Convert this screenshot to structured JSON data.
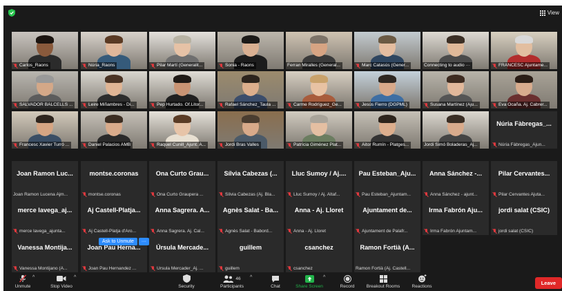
{
  "header": {
    "view_label": "View"
  },
  "video_tiles": [
    {
      "name": "Carlos_Raons",
      "muted": true,
      "wall": "#c9c4bf",
      "skin": "#8a5a3c",
      "shirt": "#2b2b2b",
      "hair": "#1b1410"
    },
    {
      "name": "Núria_Raons",
      "muted": true,
      "wall": "#d8d2cb",
      "skin": "#e0b79a",
      "shirt": "#355a7a",
      "hair": "#5a3a24"
    },
    {
      "name": "Pilar Martí (Generalit...",
      "muted": true,
      "wall": "#e4e1dc",
      "skin": "#e6c2a6",
      "shirt": "#6f6f6f",
      "hair": "#b8b3a4"
    },
    {
      "name": "Sonia - Raons",
      "muted": true,
      "wall": "#bdb7ad",
      "skin": "#d9b092",
      "shirt": "#1c1c1c",
      "hair": "#1c1a18"
    },
    {
      "name": "Ferran Miralles (General...",
      "muted": false,
      "active": true,
      "wall": "#cfc3b2",
      "skin": "#d7a483",
      "shirt": "#3a3a3a",
      "hair": "#7d7368"
    },
    {
      "name": "Marc Catasús (Gener...",
      "muted": true,
      "wall": "#c3cbd0",
      "skin": "#e4bda0",
      "shirt": "#2f4660",
      "hair": "#6b5a44"
    },
    {
      "name": "Connecting to audio ···",
      "muted": false,
      "wall": "#dedad3",
      "skin": "#e0b999",
      "shirt": "#4a4a4a",
      "hair": "#3b2f25"
    },
    {
      "name": "FRANCESC Ajuntame...",
      "muted": true,
      "wall": "#d8d0c0",
      "skin": "#e2bea0",
      "shirt": "#b22c2c",
      "hair": "#d9d9d9"
    },
    {
      "name": "SALVADOR BALCELLS ...",
      "muted": true,
      "wall": "#b9b6b0",
      "skin": "#d4a888",
      "shirt": "#5c5c5c",
      "hair": "#999"
    },
    {
      "name": "Leire Miñambres - Di...",
      "muted": true,
      "wall": "#d9d6cf",
      "skin": "#e0b595",
      "shirt": "#2d2d2d",
      "hair": "#4a3324"
    },
    {
      "name": "Pep Hurtado. Of.Litor...",
      "muted": true,
      "wall": "#e0ddd6",
      "skin": "#c99474",
      "shirt": "#202020",
      "hair": "#1f1a16"
    },
    {
      "name": "Rafael Sánchez_Taula ...",
      "muted": true,
      "wall": "#9c8b6d",
      "skin": "#dcae8c",
      "shirt": "#3b4d6b",
      "hair": "#2c241d"
    },
    {
      "name": "Carme Rodríguez_Ge...",
      "muted": true,
      "wall": "#d7cfc2",
      "skin": "#e8c2a3",
      "shirt": "#a85c3c",
      "hair": "#c9a26b"
    },
    {
      "name": "Jesús Fierro (DGPML)",
      "muted": true,
      "wall": "#c4d1db",
      "skin": "#d8a98a",
      "shirt": "#3e6ea3",
      "hair": "#2e2721"
    },
    {
      "name": "Susana Martínez (Aju...",
      "muted": true,
      "wall": "#b8b4aa",
      "skin": "#e1b89b",
      "shirt": "#555",
      "hair": "#3d2b20"
    },
    {
      "name": "Eva Ocaña. Aj. Cabrer...",
      "muted": true,
      "wall": "#a9a397",
      "skin": "#d8ac8e",
      "shirt": "#6a2f2f",
      "hair": "#2a1d16"
    },
    {
      "name": "Francesc Xavier Turró ...",
      "muted": true,
      "wall": "#d3cabb",
      "skin": "#d6a583",
      "shirt": "#3a4e65",
      "hair": "#2e251e"
    },
    {
      "name": "Daniel Palacios AMB",
      "muted": true,
      "wall": "#c6c1b8",
      "skin": "#d9ab8b",
      "shirt": "#2a2a2a",
      "hair": "#3b2d22"
    },
    {
      "name": "Raquel Cunill_Ajunt. A...",
      "muted": true,
      "wall": "#e6e2da",
      "skin": "#e7c4a8",
      "shirt": "#e8e0d2",
      "hair": "#5a3c26"
    },
    {
      "name": "Jordi Bras Valles",
      "muted": true,
      "wall": "#8a6e4e",
      "skin": "#d8aa8a",
      "shirt": "#4b5a68",
      "hair": "#4a3d30"
    },
    {
      "name": "Patrícia Giménez Plat...",
      "muted": true,
      "wall": "#d1cbc0",
      "skin": "#e4bfa2",
      "shirt": "#6b7d60",
      "hair": "#a9a49a"
    },
    {
      "name": "Aitor Rumín - Platges...",
      "muted": true,
      "wall": "#c5c0b6",
      "skin": "#dcae8d",
      "shirt": "#333",
      "hair": "#2d241c"
    },
    {
      "name": "Jordi Simó Boladeras_Aj...",
      "muted": false,
      "wall": "#dcd8d0",
      "skin": "#d9ab8c",
      "shirt": "#444",
      "hair": "#3a2e24"
    }
  ],
  "name_tile_23": {
    "big": "Núria Fàbregas_...",
    "small": "Núria Fàbregas_Ajun..."
  },
  "name_tiles": [
    {
      "big": "Joan Ramon Luc...",
      "small": "Joan Ramon Lucena Ajm...",
      "muted": false
    },
    {
      "big": "montse.coronas",
      "small": "montse.coronas",
      "muted": true
    },
    {
      "big": "Ona Curto Grau...",
      "small": "Ona Curto Graupera ...",
      "muted": true
    },
    {
      "big": "Sílvia Cabezas (...",
      "small": "Sílvia Cabezas (Aj. Bla...",
      "muted": true
    },
    {
      "big": "Lluc Sumoy / Aj....",
      "small": "Lluc Sumoy / Aj. Altaf...",
      "muted": true
    },
    {
      "big": "Pau Esteban_Aju...",
      "small": "Pau Esteban_Ajuntam...",
      "muted": true
    },
    {
      "big": "Anna Sánchez -...",
      "small": "Anna Sánchez - ajunt...",
      "muted": true
    },
    {
      "big": "Pilar Cervantes...",
      "small": "Pilar Cervantes Ajuta...",
      "muted": true
    },
    {
      "big": "merce lavega_aj...",
      "small": "merce lavega_ajunta...",
      "muted": true
    },
    {
      "big": "Aj Castell-Platja...",
      "small": "Aj Castell-Platja d'Aro...",
      "muted": true
    },
    {
      "big": "Anna Sagrera. A...",
      "small": "Anna Sagrera. Aj. Cal...",
      "muted": true
    },
    {
      "big": "Agnès Salat - Ba...",
      "small": "Agnès Salat - Babord...",
      "muted": true
    },
    {
      "big": "Anna - Aj. Lloret",
      "small": "Anna - Aj. Lloret",
      "muted": true
    },
    {
      "big": "Ajuntament de...",
      "small": "Ajuntament de Palafr...",
      "muted": true
    },
    {
      "big": "Irma Fabrón Aju...",
      "small": "Irma Fabrón Ajuntam...",
      "muted": true
    },
    {
      "big": "jordi salat (CSIC)",
      "small": "jordi salat (CSIC)",
      "muted": true
    },
    {
      "big": "Vanessa Montija...",
      "small": "Vanessa Montijano (A...",
      "muted": true
    },
    {
      "big": "Joan Pau Herna...",
      "small": "Joan Pau Hernandez ...",
      "muted": true
    },
    {
      "big": "Úrsula Mercade...",
      "small": "Úrsula Mercader_Aj. ...",
      "muted": true
    },
    {
      "big": "guillem",
      "small": "guillem",
      "muted": true
    },
    {
      "big": "csanchez",
      "small": "csanchez",
      "muted": true
    },
    {
      "big": "Ramon Fortià (A...",
      "small": "Ramon Fortià (Aj. Castell...",
      "muted": false
    }
  ],
  "popup": {
    "unmute_label": "Ask to Unmute",
    "more_label": "···"
  },
  "toolbar": {
    "unmute": "Unmute",
    "stop_video": "Stop Video",
    "security": "Security",
    "participants": "Participants",
    "participants_count": "46",
    "chat": "Chat",
    "share_screen": "Share Screen",
    "record": "Record",
    "breakout": "Breakout Rooms",
    "reactions": "Reactions",
    "leave": "Leave"
  },
  "colors": {
    "accent_share": "#22b34a",
    "leave": "#e02828",
    "active_speaker": "#b8e04a",
    "muted_red": "#e0393e",
    "shield_green": "#27c24c"
  }
}
